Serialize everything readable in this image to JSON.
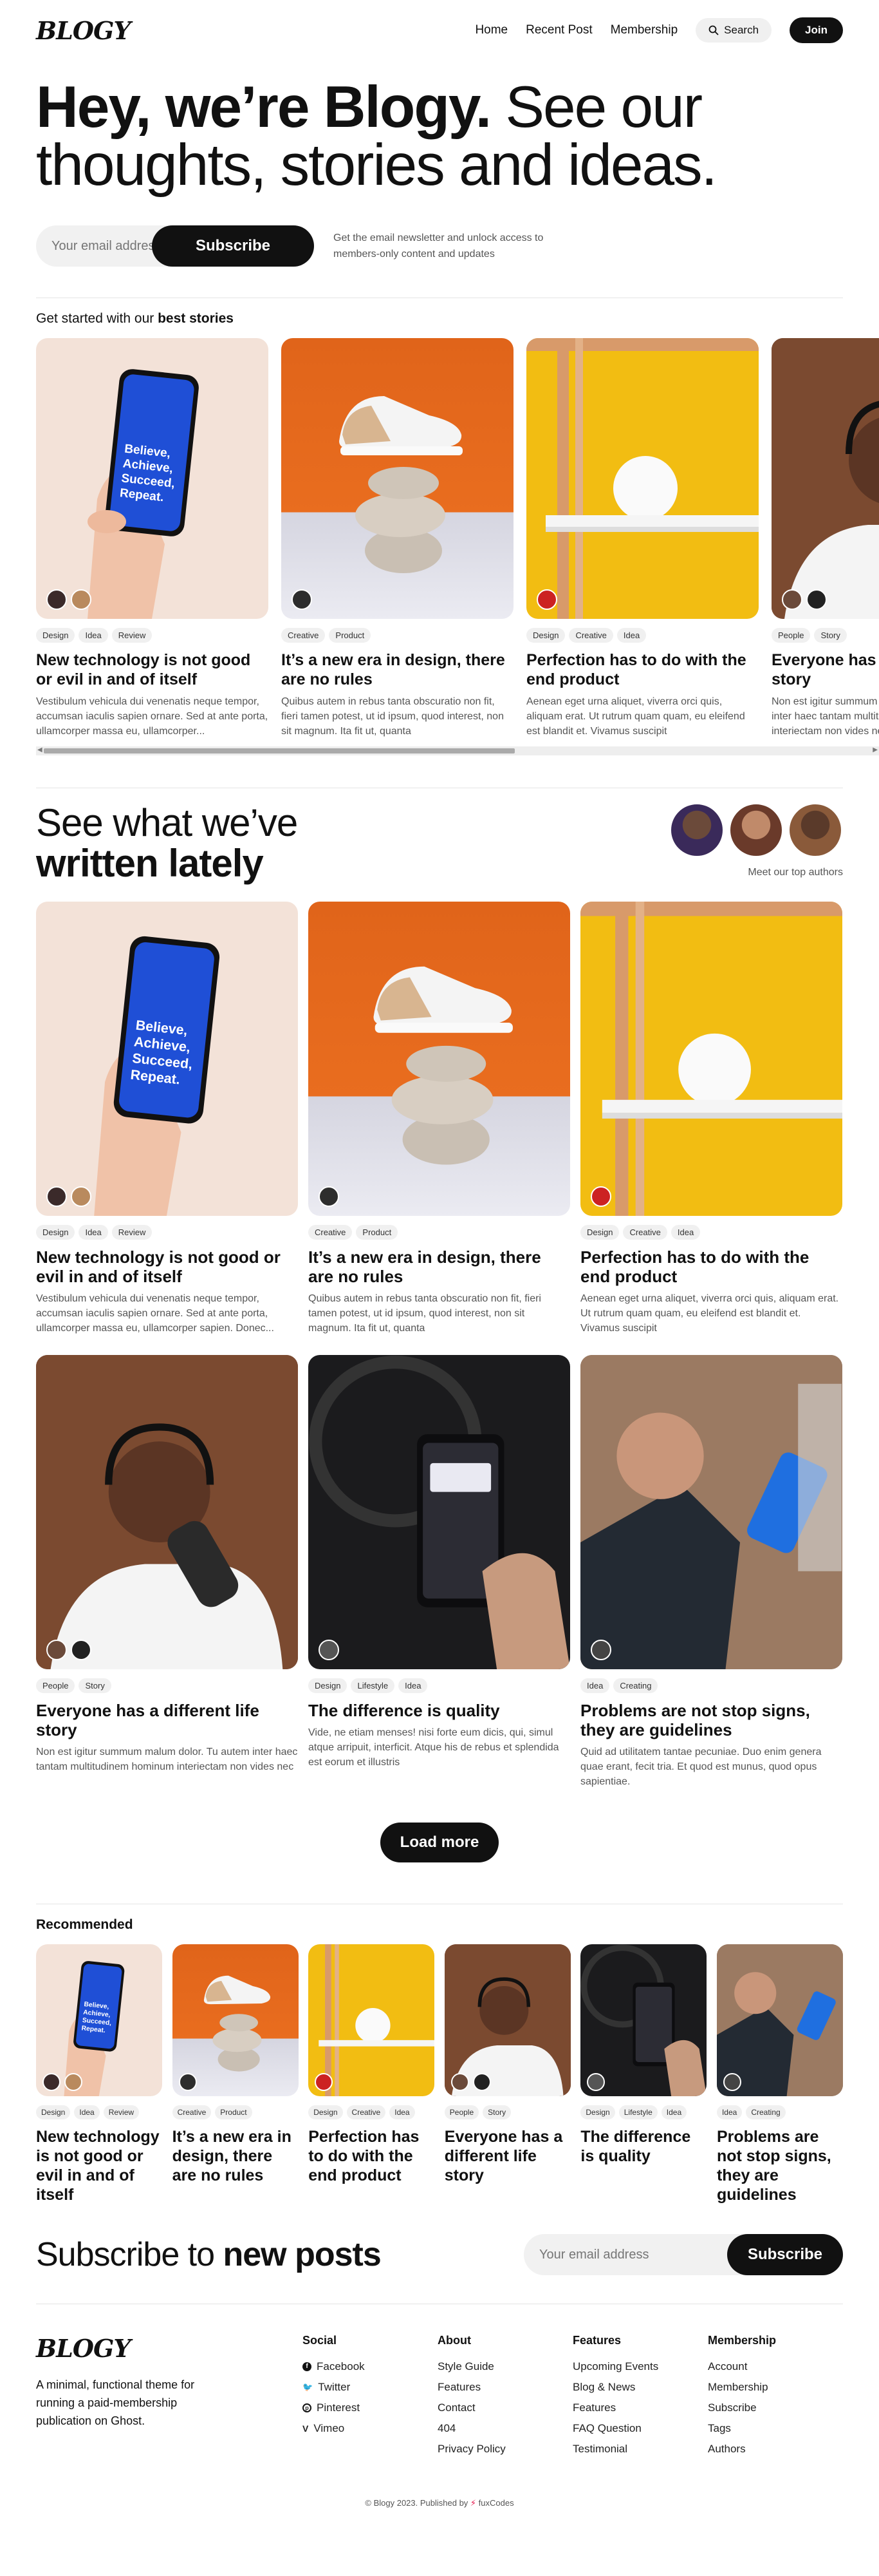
{
  "header": {
    "logo": "BLOGY",
    "nav": [
      "Home",
      "Recent Post",
      "Membership"
    ],
    "search_label": "Search",
    "join_label": "Join"
  },
  "hero": {
    "bold": "Hey, we’re Blogy.",
    "rest": " See our thoughts, stories and ideas.",
    "email_placeholder": "Your email address",
    "subscribe_label": "Subscribe",
    "note": "Get the email newsletter and unlock access to members-only content and updates"
  },
  "stories": {
    "label_prefix": "Get started with our ",
    "label_bold": "best stories",
    "items": [
      {
        "tags": [
          "Design",
          "Idea",
          "Review"
        ],
        "title": "New technology is not good or evil in and of itself",
        "excerpt": "Vestibulum vehicula dui venenatis neque tempor, accumsan iaculis sapien ornare. Sed at ante porta, ullamcorper massa eu, ullamcorper..."
      },
      {
        "tags": [
          "Creative",
          "Product"
        ],
        "title": "It’s a new era in design, there are no rules",
        "excerpt": "Quibus autem in rebus tanta obscuratio non fit, fieri tamen potest, ut id ipsum, quod interest, non sit magnum. Ita fit ut, quanta"
      },
      {
        "tags": [
          "Design",
          "Creative",
          "Idea"
        ],
        "title": "Perfection has to do with the end product",
        "excerpt": "Aenean eget urna aliquet, viverra orci quis, aliquam erat. Ut rutrum quam quam, eu eleifend est blandit et. Vivamus suscipit"
      },
      {
        "tags": [
          "People",
          "Story"
        ],
        "title": "Everyone has a different life story",
        "excerpt": "Non est igitur summum malum dolor. Tu autem inter haec tantam multitudinem hominum interiectam non vides nec"
      }
    ]
  },
  "latest": {
    "title_light": "See what we’ve",
    "title_bold": "written lately",
    "authors_label": "Meet our top authors",
    "load_more": "Load more",
    "posts": [
      {
        "tags": [
          "Design",
          "Idea",
          "Review"
        ],
        "title": "New technology is not good or evil in and of itself",
        "excerpt": "Vestibulum vehicula dui venenatis neque tempor, accumsan iaculis sapien ornare. Sed at ante porta, ullamcorper massa eu, ullamcorper sapien. Donec..."
      },
      {
        "tags": [
          "Creative",
          "Product"
        ],
        "title": "It’s a new era in design, there are no rules",
        "excerpt": "Quibus autem in rebus tanta obscuratio non fit, fieri tamen potest, ut id ipsum, quod interest, non sit magnum. Ita fit ut, quanta"
      },
      {
        "tags": [
          "Design",
          "Creative",
          "Idea"
        ],
        "title": "Perfection has to do with the end product",
        "excerpt": "Aenean eget urna aliquet, viverra orci quis, aliquam erat. Ut rutrum quam quam, eu eleifend est blandit et. Vivamus suscipit"
      },
      {
        "tags": [
          "People",
          "Story"
        ],
        "title": "Everyone has a different life story",
        "excerpt": "Non est igitur summum malum dolor. Tu autem inter haec tantam multitudinem hominum interiectam non vides nec"
      },
      {
        "tags": [
          "Design",
          "Lifestyle",
          "Idea"
        ],
        "title": "The difference is quality",
        "excerpt": "Vide, ne etiam menses! nisi forte eum dicis, qui, simul atque arripuit, interficit. Atque his de rebus et splendida est eorum et illustris"
      },
      {
        "tags": [
          "Idea",
          "Creating"
        ],
        "title": "Problems are not stop signs, they are guidelines",
        "excerpt": "Quid ad utilitatem tantae pecuniae. Duo enim genera quae erant, fecit tria. Et quod est munus, quod opus sapientiae."
      }
    ]
  },
  "recommended": {
    "label": "Recommended",
    "posts": [
      {
        "tags": [
          "Design",
          "Idea",
          "Review"
        ],
        "title": "New technology is not good or evil in and of itself"
      },
      {
        "tags": [
          "Creative",
          "Product"
        ],
        "title": "It’s a new era in design, there are no rules"
      },
      {
        "tags": [
          "Design",
          "Creative",
          "Idea"
        ],
        "title": "Perfection has to do with the end product"
      },
      {
        "tags": [
          "People",
          "Story"
        ],
        "title": "Everyone has a different life story"
      },
      {
        "tags": [
          "Design",
          "Lifestyle",
          "Idea"
        ],
        "title": "The difference is quality"
      },
      {
        "tags": [
          "Idea",
          "Creating"
        ],
        "title": "Problems are not stop signs, they are guidelines"
      }
    ]
  },
  "bottom_subscribe": {
    "title_light": "Subscribe to ",
    "title_bold": "new posts",
    "email_placeholder": "Your email address",
    "subscribe_label": "Subscribe"
  },
  "footer": {
    "logo": "BLOGY",
    "description": "A minimal, functional theme for running a paid-membership publication on Ghost.",
    "columns": [
      {
        "title": "Social",
        "links": [
          "Facebook",
          "Twitter",
          "Pinterest",
          "Vimeo"
        ]
      },
      {
        "title": "About",
        "links": [
          "Style Guide",
          "Features",
          "Contact",
          "404",
          "Privacy Policy"
        ]
      },
      {
        "title": "Features",
        "links": [
          "Upcoming Events",
          "Blog & News",
          "Features",
          "FAQ Question",
          "Testimonial"
        ]
      },
      {
        "title": "Membership",
        "links": [
          "Account",
          "Membership",
          "Subscribe",
          "Tags",
          "Authors"
        ]
      }
    ],
    "social_icons": [
      "facebook-icon",
      "twitter-icon",
      "pinterest-icon",
      "vimeo-icon"
    ],
    "copyright_prefix": "© Blogy 2023. Published by ",
    "copyright_brand": "fuxCodes"
  }
}
